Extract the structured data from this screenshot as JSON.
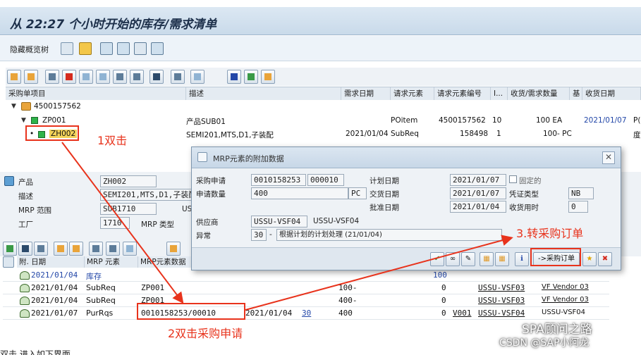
{
  "window": {
    "title": "从 22:27 个小时开始的库存/需求清单"
  },
  "toolbar": {
    "hide_label": "隐藏概览树"
  },
  "tree": {
    "headers": [
      "采购单项目",
      "描述",
      "需求日期",
      "请求元素",
      "请求元素编号",
      "I...",
      "收货/需求数量",
      "基",
      "收货日期"
    ],
    "rows": [
      {
        "label": "4500157562",
        "desc": "",
        "date": "",
        "elem": "",
        "num": "",
        "i": "",
        "qty": "",
        "uom": "",
        "rdate": "",
        "extra": ""
      },
      {
        "label": "ZP001",
        "desc": "产品SUB01",
        "date": "",
        "elem": "POitem",
        "num": "4500157562",
        "i": "10",
        "qty": "100 EA",
        "uom": "",
        "rdate": "2021/01/07",
        "extra": "P("
      },
      {
        "label": "ZH002",
        "desc": "SEMI201,MTS,D1,子装配",
        "date": "2021/01/04",
        "elem": "SubReq",
        "num": "158498",
        "i": "1",
        "qty": "100- PC",
        "uom": "",
        "rdate": "",
        "extra": "度"
      }
    ]
  },
  "detail": {
    "product_label": "产品",
    "product_value": "ZH002",
    "desc_label": "描述",
    "desc_value": "SEMI201,MTS,D1,子装配",
    "mrp_area_label": "MRP 范围",
    "mrp_area_value": "SUB1710",
    "mrp_area_extra": "US",
    "plant_label": "工厂",
    "plant_value": "1710",
    "mrp_type_label": "MRP 类型"
  },
  "dialog": {
    "title": "MRP元素的附加数据",
    "pr_label": "采购申请",
    "pr_number": "0010158253",
    "pr_item": "000010",
    "plan_date_label": "计划日期",
    "plan_date": "2021/01/07",
    "fixed_label": "固定的",
    "qty_label": "申请数量",
    "qty": "400",
    "uom": "PC",
    "deliv_date_label": "交货日期",
    "deliv_date": "2021/01/07",
    "doc_type_label": "凭证类型",
    "doc_type": "NB",
    "release_label": "批准日期",
    "release_date": "2021/01/04",
    "gr_time_label": "收货用时",
    "gr_time": "0",
    "vendor_label": "供应商",
    "vendor": "USSU-VSF04",
    "vendor_name": "USSU-VSF04",
    "exception_label": "异常",
    "exception_code": "30",
    "exception_sep": "-",
    "exception_text": "根据计划的计划处理 (21/01/04)",
    "to_po_button": "->采购订单"
  },
  "grid": {
    "headers": [
      "附. 日期",
      "MRP 元素",
      "MRP元素数据"
    ],
    "rows": [
      {
        "date": "2021/01/04",
        "elem": "库存",
        "data": "",
        "resched": "",
        "ex": "",
        "recv": "",
        "avail": "100",
        "vendor_code": "",
        "vendor": "",
        "vendor_name": ""
      },
      {
        "date": "2021/01/04",
        "elem": "SubReq",
        "data": "ZP001",
        "resched": "",
        "ex": "",
        "recv": "100-",
        "avail": "0",
        "vendor_code": "",
        "vendor": "USSU-VSF03",
        "vendor_name": "VF Vendor 03"
      },
      {
        "date": "2021/01/04",
        "elem": "SubReq",
        "data": "ZP001",
        "resched": "",
        "ex": "",
        "recv": "400-",
        "avail": "0",
        "vendor_code": "",
        "vendor": "USSU-VSF03",
        "vendor_name": "VF Vendor 03"
      },
      {
        "date": "2021/01/07",
        "elem": "PurRqs",
        "data": "0010158253/00010",
        "resched": "2021/01/04",
        "ex": "30",
        "recv": "400",
        "avail": "0",
        "vendor_code": "V001",
        "vendor": "USSU-VSF04",
        "vendor_name": "USSU-VSF04"
      }
    ]
  },
  "annotations": {
    "step1": "1双击",
    "step2": "2双击采购申请",
    "step3": "3.转采购订单"
  },
  "watermark": {
    "line1": "SPA顾问之路",
    "line2": "CSDN @SAP小阿龙"
  },
  "bottom_text": "双击        进入如下界面"
}
